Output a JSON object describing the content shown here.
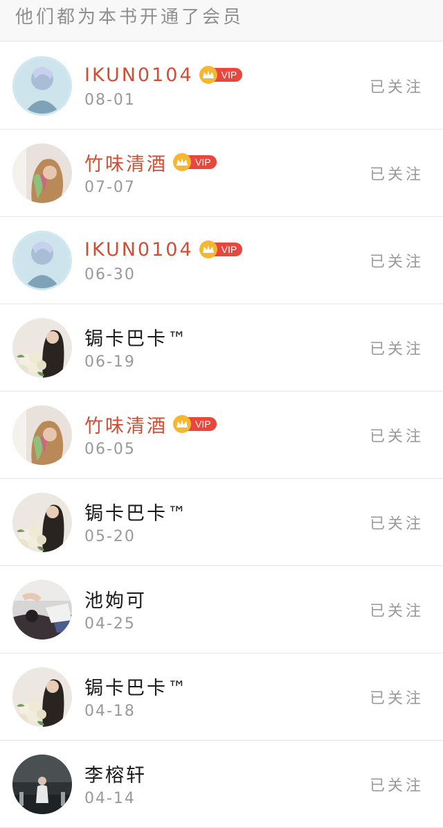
{
  "header": {
    "title": "他们都为本书开通了会员"
  },
  "vip_label": "VIP",
  "follow_label": "已关注",
  "rows": [
    {
      "name": "IKUN0104",
      "date": "08-01",
      "vip": true
    },
    {
      "name": "竹味清酒",
      "date": "07-07",
      "vip": true
    },
    {
      "name": "IKUN0104",
      "date": "06-30",
      "vip": true
    },
    {
      "name": "锔卡巴卡™",
      "date": "06-19",
      "vip": false
    },
    {
      "name": "竹味清酒",
      "date": "06-05",
      "vip": true
    },
    {
      "name": "锔卡巴卡™",
      "date": "05-20",
      "vip": false
    },
    {
      "name": "池姁可",
      "date": "04-25",
      "vip": false
    },
    {
      "name": "锔卡巴卡™",
      "date": "04-18",
      "vip": false
    },
    {
      "name": "李榕轩",
      "date": "04-14",
      "vip": false
    }
  ],
  "colors": {
    "vip_name": "#d14d33",
    "vip_badge": "#e8473e",
    "crown": "#f5b630"
  }
}
